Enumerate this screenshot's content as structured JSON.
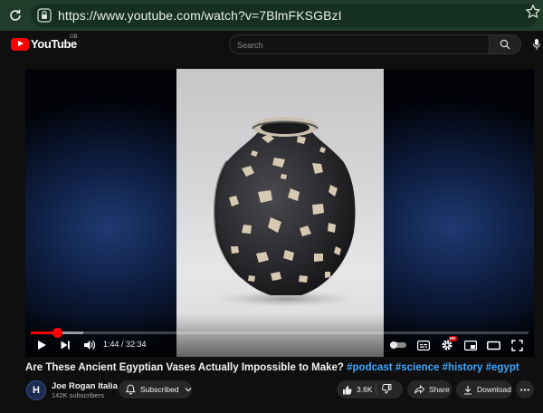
{
  "browser": {
    "url": "https://www.youtube.com/watch?v=7BlmFKSGBzI"
  },
  "masthead": {
    "logo_text": "YouTube",
    "country_code": "GB",
    "search_placeholder": "Search"
  },
  "player": {
    "time_display": "1:44 / 32:34",
    "progress_fraction": 0.053,
    "buffered_fraction": 0.105,
    "settings_badge": "HD"
  },
  "video": {
    "title_text": "Are These Ancient Egyptian Vases Actually Impossible to Make?",
    "hashtags": [
      "#podcast",
      "#science",
      "#history",
      "#egypt"
    ]
  },
  "channel": {
    "avatar_letter": "H",
    "name": "Joe Rogan Italia",
    "subscribers": "142K subscribers"
  },
  "actions": {
    "subscribed_label": "Subscribed",
    "like_count": "3.6K",
    "share_label": "Share",
    "download_label": "Download"
  },
  "colors": {
    "accent": "#ff0000",
    "hashtag": "#3ea6ff",
    "background": "#0f0f0f",
    "browser_bar": "#1f3d2a"
  }
}
